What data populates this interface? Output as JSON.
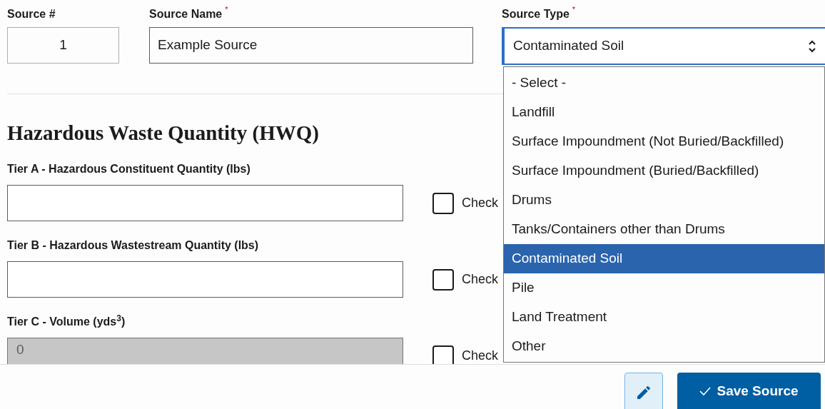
{
  "source_number": {
    "label": "Source #",
    "value": "1"
  },
  "source_name": {
    "label": "Source Name",
    "required_mark": "*",
    "value": "Example Source"
  },
  "source_type": {
    "label": "Source Type",
    "required_mark": "*",
    "value": "Contaminated Soil",
    "expanded": true,
    "options": [
      {
        "label": "- Select -",
        "selected": false
      },
      {
        "label": "Landfill",
        "selected": false
      },
      {
        "label": "Surface Impoundment (Not Buried/Backfilled)",
        "selected": false
      },
      {
        "label": "Surface Impoundment (Buried/Backfilled)",
        "selected": false
      },
      {
        "label": "Drums",
        "selected": false
      },
      {
        "label": "Tanks/Containers other than Drums",
        "selected": false
      },
      {
        "label": "Contaminated Soil",
        "selected": true
      },
      {
        "label": "Pile",
        "selected": false
      },
      {
        "label": "Land Treatment",
        "selected": false
      },
      {
        "label": "Other",
        "selected": false
      }
    ]
  },
  "section": {
    "heading": "Hazardous Waste Quantity (HWQ)",
    "tiers": [
      {
        "label": "Tier A - Hazardous Constituent Quantity (lbs)",
        "disabled": false,
        "checkbox": {
          "label": "Check",
          "checked": false
        }
      },
      {
        "label": "Tier B - Hazardous Wastestream Quantity (lbs)",
        "disabled": false,
        "checkbox": {
          "label": "Check",
          "checked": false
        }
      },
      {
        "label": "Tier C - Volume (yds$^{3}$)",
        "value": "0",
        "disabled": true,
        "checkbox": {
          "label": "Check",
          "checked": false
        }
      }
    ]
  },
  "footer": {
    "save_button": "Save Source"
  }
}
